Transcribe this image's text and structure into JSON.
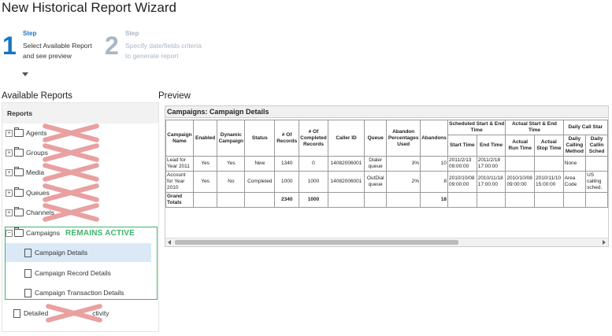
{
  "wizard": {
    "title": "New Historical Report Wizard",
    "steps": [
      {
        "number": "1",
        "label": "Step",
        "description": "Select Available Report and see preview"
      },
      {
        "number": "2",
        "label": "Step",
        "description": "Specify date/fields criteria to generate report"
      }
    ]
  },
  "available_reports": {
    "heading": "Available Reports",
    "tree_header": "Reports",
    "nodes": [
      {
        "label": "Agents",
        "expander": "+"
      },
      {
        "label": "Groups",
        "expander": "+"
      },
      {
        "label": "Media",
        "expander": "+"
      },
      {
        "label": "Queues",
        "expander": "+"
      },
      {
        "label": "Channels",
        "expander": "+"
      },
      {
        "label": "Campaigns",
        "expander": "−"
      }
    ],
    "children": [
      {
        "label": "Campaign Details",
        "selected": true
      },
      {
        "label": "Campaign Record Details"
      },
      {
        "label": "Campaign Transaction Details"
      }
    ],
    "last_node": {
      "label_left": "Detailed",
      "label_right": "ctivity"
    },
    "annotation": "REMAINS ACTIVE"
  },
  "preview": {
    "heading": "Preview",
    "table_title": "Campaigns: Campaign Details",
    "headers": {
      "campaign_name": "Campaign Name",
      "enabled": "Enabled",
      "dynamic": "Dynamic Campaign",
      "status": "Status",
      "records": "# Of Records",
      "completed": "# Of Completed Records",
      "caller_id": "Caller ID",
      "queue": "Queue",
      "abandon_pct": "Abandon Percentages Used",
      "abandons": "Abandons",
      "scheduled": "Scheduled Start & End Time",
      "actual": "Actual Start & End Time",
      "daily": "Daily Call Star",
      "start_time": "Start Time",
      "end_time": "End Time",
      "actual_run": "Actual Run Time",
      "actual_stop": "Actual Stop Time",
      "daily_method": "Daily Calling Method",
      "daily_sched": "Daily Callin Sched"
    },
    "rows": [
      [
        "Lead for Year 2011",
        "Yes",
        "Yes",
        "New",
        "1340",
        "0",
        "14082006001",
        "Dialer queue",
        "3%",
        "10",
        "2011/2/13 09:00:00",
        "2011/2/18 17:00:00",
        "",
        "",
        "None",
        ""
      ],
      [
        "Account for Year 2010",
        "Yes",
        "No",
        "Completed",
        "1000",
        "1000",
        "14082006001",
        "OutDial queue",
        "2%",
        "8",
        "2010/10/08 09:00:00",
        "2010/11/18 17:00:00",
        "2010/10/08 09:00:00",
        "2010/11/10 15:00:00",
        "Area Code",
        "US calling sched."
      ]
    ],
    "totals": {
      "label": "Grand Totals",
      "records": "2340",
      "completed": "1000",
      "abandons": "18"
    }
  },
  "colors": {
    "accent": "#1a74c4",
    "muted": "#aab6c4",
    "green": "#3fb36b",
    "cross": "#e9a0a0",
    "selected": "#dbe9f7"
  },
  "icons": [
    "folder-icon",
    "document-icon",
    "expand-icon",
    "collapse-icon",
    "chevron-down-icon"
  ]
}
